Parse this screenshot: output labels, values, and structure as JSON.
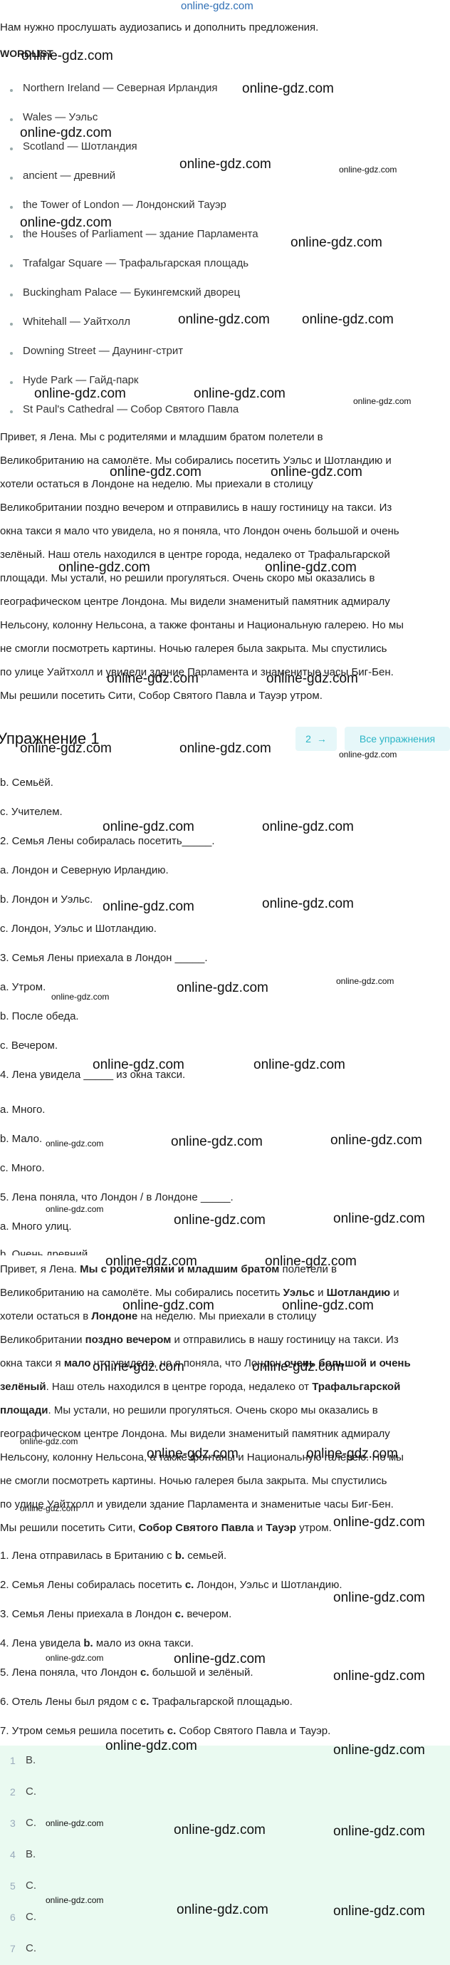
{
  "logo": "online-gdz.com",
  "intro": "Нам нужно прослушать аудиозапись и дополнить предложения.",
  "wordlist": {
    "title": "WORDLIST",
    "items": [
      "Northern Ireland — Северная Ирландия",
      "Wales — Уэльс",
      "Scotland — Шотландия",
      "ancient — древний",
      "the Tower of London — Лондонский Тауэр",
      "the Houses of Parliament — здание Парламента",
      "Trafalgar Square — Трафальгарская площадь",
      "Buckingham Palace — Букингемский дворец",
      "Whitehall — Уайтхолл",
      "Downing Street — Даунинг-стрит",
      "Hyde Park — Гайд-парк",
      "St Paul's Cathedral — Собор Святого Павла"
    ]
  },
  "text1": [
    "Привет, я Лена. Мы с родителями и младшим братом полетели в",
    "Великобританию на самолёте. Мы собирались посетить Уэльс и Шотландию и",
    "хотели остаться в Лондоне на неделю. Мы приехали в столицу",
    "Великобритании поздно вечером и отправились в нашу гостиницу на такси. Из",
    "окна такси я мало что увидела, но я поняла, что Лондон очень большой и очень",
    "зелёный. Наш отель находился в центре города, недалеко от Трафальгарской",
    "площади. Мы устали, но решили прогуляться. Очень скоро мы оказались в",
    "географическом центре Лондона. Мы видели знаменитый памятник адмиралу",
    "Нельсону, колонну Нельсона, а также фонтаны и Национальную галерею. Но мы",
    "не смогли посмотреть картины. Ночью галерея была закрыта. Мы спустились",
    "по улице Уайтхолл и увидели здание Парламента и знаменитые часы Биг-Бен.",
    "Мы решили посетить Сити, Собор Святого Павла и Тауэр утром."
  ],
  "exercise": {
    "title": "Упражнение 1",
    "nav_next": "2",
    "nav_all": "Все упражнения"
  },
  "questions": [
    "b. Семьёй.",
    "c. Учителем.",
    "2. Семья Лены собиралась посетить_____.",
    "a. Лондон и Северную Ирландию.",
    "b. Лондон и Уэльс.",
    "c. Лондон, Уэльс и Шотландию.",
    "3. Семья Лены приехала в Лондон _____.",
    "a. Утром.",
    "b. После обеда.",
    "c. Вечером.",
    "4. Лена увидела _____ из окна такси.",
    "a. Много.",
    "b. Мало.",
    "c. Много.",
    "5. Лена поняла, что Лондон / в Лондоне _____.",
    "a. Много улиц.",
    "b. Очень древний"
  ],
  "text2": {
    "l1a": "Привет, я Лена. ",
    "l1b": "Мы с родителями и младшим братом",
    "l1c": " полетели в",
    "l2a": "Великобританию на самолёте. Мы собирались посетить ",
    "l2b": "Уэльс",
    "l2c": " и ",
    "l2d": "Шотландию",
    "l2e": " и",
    "l3a": "хотели остаться в ",
    "l3b": "Лондоне",
    "l3c": " на неделю. Мы приехали в столицу",
    "l4a": "Великобритании ",
    "l4b": "поздно вечером",
    "l4c": " и отправились в нашу гостиницу на такси. Из",
    "l5a": "окна такси я ",
    "l5b": "мало",
    "l5c": " что увидела, но я поняла, что Лондон ",
    "l5d": "очень большой и очень",
    "l6a": "зелёный",
    "l6b": ". Наш отель находился в центре города, недалеко от ",
    "l6c": "Трафальгарской",
    "l7a": "площади",
    "l7b": ". Мы устали, но решили прогуляться. Очень скоро мы оказались в",
    "l8": "географическом центре Лондона. Мы видели знаменитый памятник адмиралу",
    "l9": "Нельсону, колонну Нельсона, а также фонтаны и Национальную галерею. Но мы",
    "l10": "не смогли посмотреть картины. Ночью галерея была закрыта. Мы спустились",
    "l11": "по улице Уайтхолл и увидели здание Парламента и знаменитые часы Биг-Бен.",
    "l12a": "Мы решили посетить Сити, ",
    "l12b": "Собор Святого Павла",
    "l12c": " и ",
    "l12d": "Тауэр",
    "l12e": " утром."
  },
  "answers_text": [
    {
      "a": "1. Лена отправилась в Британию с ",
      "b": "b.",
      "c": " семьей."
    },
    {
      "a": "2. Семья Лены собиралась посетить ",
      "b": "c.",
      "c": " Лондон, Уэльс и Шотландию."
    },
    {
      "a": "3. Семья Лены приехала в Лондон ",
      "b": "c.",
      "c": " вечером."
    },
    {
      "a": "4. Лена увидела ",
      "b": "b.",
      "c": " мало из окна такси."
    },
    {
      "a": "5. Лена поняла, что Лондон ",
      "b": "c.",
      "c": " большой и зелёный."
    },
    {
      "a": "6. Отель Лены был рядом с ",
      "b": "c.",
      "c": " Трафальгарской площадью."
    },
    {
      "a": "7. Утром семья решила посетить ",
      "b": "c.",
      "c": " Собор Святого Павла и Тауэр."
    }
  ],
  "answers_list": [
    {
      "n": "1",
      "v": "B."
    },
    {
      "n": "2",
      "v": "C."
    },
    {
      "n": "3",
      "v": "C."
    },
    {
      "n": "4",
      "v": "B."
    },
    {
      "n": "5",
      "v": "C."
    },
    {
      "n": "6",
      "v": "C."
    },
    {
      "n": "7",
      "v": "C."
    }
  ],
  "colors": {
    "accent": "#2bb5c6",
    "nav_bg": "#e6f7f9",
    "answers_bg": "#eafaf1"
  }
}
